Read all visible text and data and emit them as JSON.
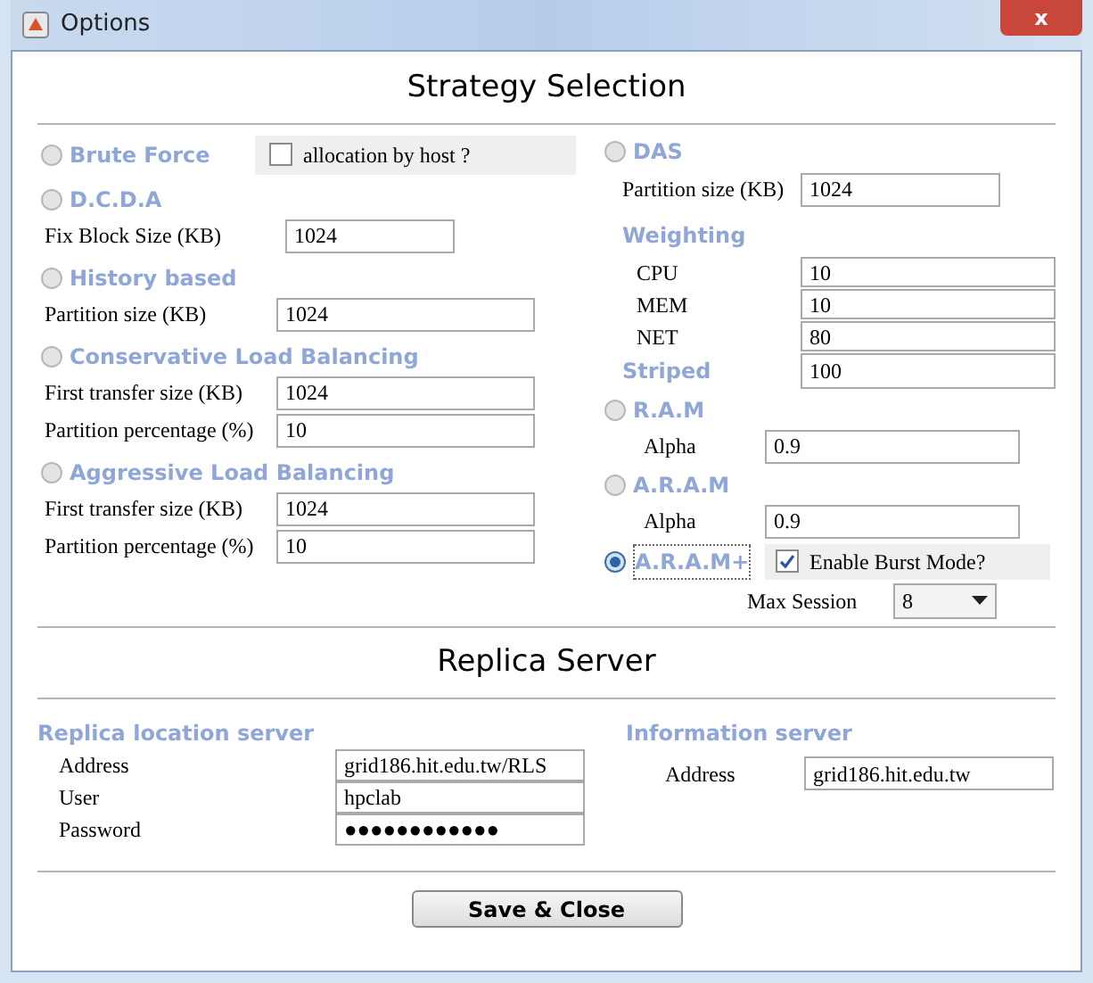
{
  "window": {
    "title": "Options",
    "close": "x"
  },
  "strategy_section": {
    "title": "Strategy Selection"
  },
  "strategies_left": [
    {
      "kind": "brute",
      "label": "Brute Force",
      "selected": false,
      "option": {
        "label": "allocation by host ?",
        "checked": false
      }
    },
    {
      "kind": "fields",
      "label": "D.C.D.A",
      "selected": false,
      "fields": [
        {
          "label": "Fix Block Size (KB)",
          "value": "1024"
        }
      ]
    },
    {
      "kind": "fields",
      "label": "History based",
      "selected": false,
      "fields": [
        {
          "label": "Partition size (KB)",
          "value": "1024"
        }
      ]
    },
    {
      "kind": "fields",
      "label": "Conservative Load Balancing",
      "selected": false,
      "fields": [
        {
          "label": "First transfer size (KB)",
          "value": "1024"
        },
        {
          "label": "Partition percentage (%)",
          "value": "10"
        }
      ]
    },
    {
      "kind": "fields",
      "label": "Aggressive Load Balancing",
      "selected": false,
      "fields": [
        {
          "label": "First transfer size (KB)",
          "value": "1024"
        },
        {
          "label": "Partition percentage (%)",
          "value": "10"
        }
      ]
    }
  ],
  "strategies_right": [
    {
      "kind": "das",
      "label": "DAS",
      "selected": false,
      "fields": [
        {
          "label": "Partition size (KB)",
          "value": "1024"
        }
      ],
      "weighting": {
        "label": "Weighting",
        "fields": [
          {
            "label": "CPU",
            "value": "10"
          },
          {
            "label": "MEM",
            "value": "10"
          },
          {
            "label": "NET",
            "value": "80"
          }
        ]
      },
      "striped": {
        "label": "Striped",
        "value": "100"
      }
    },
    {
      "kind": "fields",
      "label": "R.A.M",
      "selected": false,
      "fields": [
        {
          "label": "Alpha",
          "value": "0.9"
        }
      ]
    },
    {
      "kind": "fields",
      "label": "A.R.A.M",
      "selected": false,
      "fields": [
        {
          "label": "Alpha",
          "value": "0.9"
        }
      ]
    },
    {
      "kind": "burst",
      "label": "A.R.A.M+",
      "selected": true,
      "option": {
        "label": "Enable Burst Mode?",
        "checked": true
      },
      "max_session": {
        "label": "Max Session",
        "value": "8"
      }
    }
  ],
  "replica_section": {
    "title": "Replica Server",
    "replica_location": {
      "title": "Replica location server",
      "fields": [
        {
          "label": "Address",
          "value": "grid186.hit.edu.tw/RLS"
        },
        {
          "label": "User",
          "value": "hpclab"
        },
        {
          "label": "Password",
          "value": "●●●●●●●●●●●●"
        }
      ]
    },
    "information_server": {
      "title": "Information server",
      "fields": [
        {
          "label": "Address",
          "value": "grid186.hit.edu.tw"
        }
      ]
    }
  },
  "buttons": [
    "Save & Close"
  ]
}
